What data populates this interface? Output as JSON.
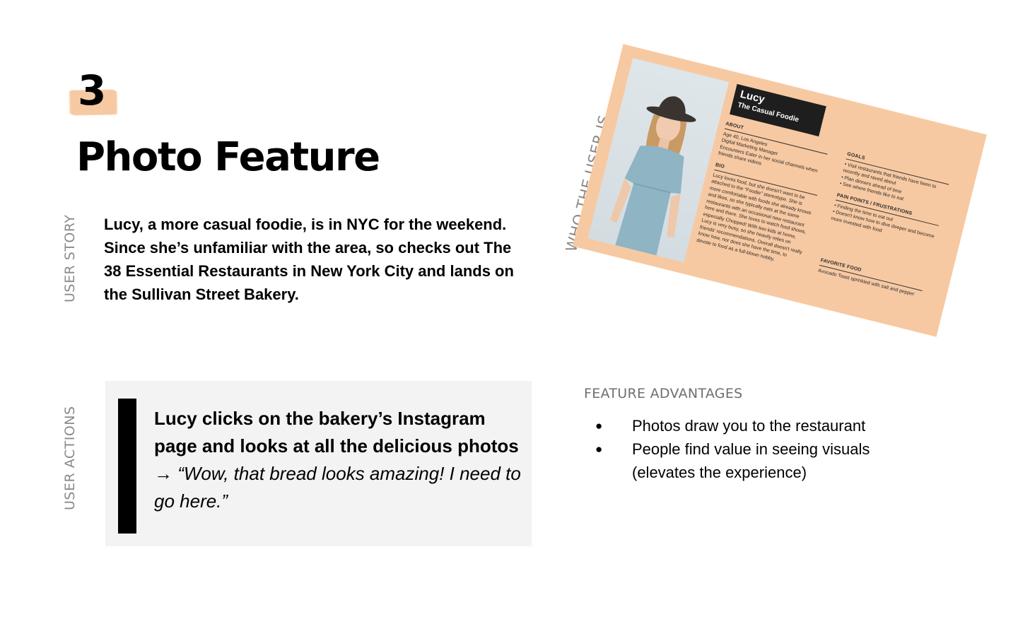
{
  "number": "3",
  "title": "Photo Feature",
  "user_story": {
    "label": "USER STORY",
    "text": "Lucy, a more casual foodie, is in NYC for the weekend. Since she’s unfamiliar with the area, so checks out The 38 Essential Restaurants in New York City and lands on the Sullivan Street Bakery."
  },
  "user_actions": {
    "label": "USER ACTIONS",
    "quote_bold": "Lucy clicks on the bakery’s Instagram page and looks at all the delicious photos",
    "arrow": " → ",
    "quote_italic": "“Wow, that bread looks amazing! I need to go here.”"
  },
  "feature_advantages": {
    "heading": "FEATURE ADVANTAGES",
    "items": [
      "Photos draw you to the restaurant",
      "People find value in seeing visuals (elevates the experience)"
    ]
  },
  "persona": {
    "side_label": "WHO THE USER IS",
    "name": "Lucy",
    "subtitle": "The Casual Foodie",
    "about_heading": "ABOUT",
    "about_items": [
      "Age 40, Los Angeles",
      "Digital Marketing Manager",
      "Encounters Eater in her social channels when friends share videos"
    ],
    "bio_heading": "BIO",
    "bio_text": "Lucy loves food, but she doesn't want to be attached to the “Foodie” stereotype. She is more comfortable with foods she already knows and likes, so she typically eats at the same restaurants with an occasional new restaurant here and there. She loves to watch food shows, especially Chopped! With two kids at home, Lucy is very busy, so she heavily relies on friends' recommendations. Overall doesn't really know how, nor does she have the time, to devote to food as a full-blown hobby.",
    "goals_heading": "GOALS",
    "goals_items": [
      "• Visit restaurants that friends have been to recently and raved about",
      "• Plan dinners ahead of time",
      "• See where friends like to eat"
    ],
    "pain_heading": "PAIN POINTS / FRUSTRATIONS",
    "pain_items": [
      "• Finding the time to eat out",
      "• Doesn't know how to dive deeper and become more invested with food"
    ],
    "fav_heading": "FAVORITE FOOD",
    "fav_text": "Avocado Toast sprinkled with salt and pepper"
  },
  "colors": {
    "accent_peach": "#f7c9a2",
    "quote_bg": "#f3f3f3",
    "label_gray": "#8a8a8a"
  }
}
